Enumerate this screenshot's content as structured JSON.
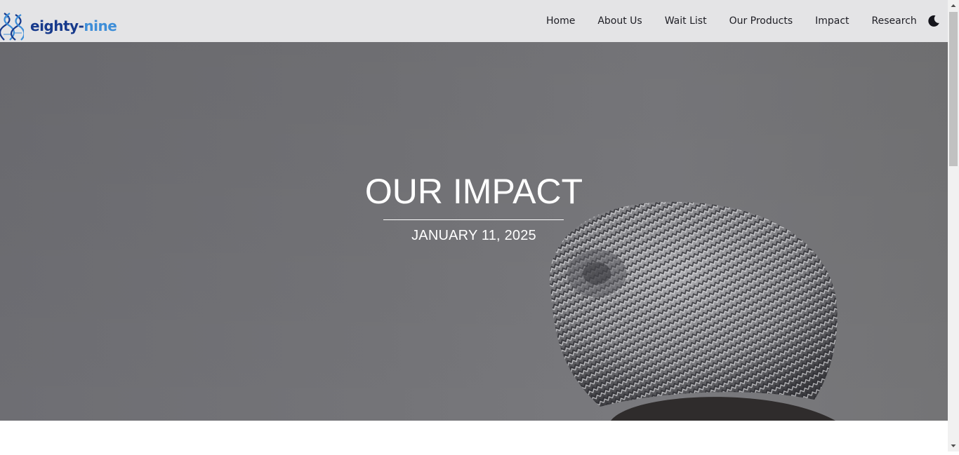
{
  "brand": {
    "name_part1": "eighty-",
    "name_part2": "nine",
    "logo_icon": "dna-helix-logo",
    "color_dark": "#173a8c",
    "color_light": "#3e8ed8"
  },
  "nav": {
    "items": [
      {
        "label": "Home"
      },
      {
        "label": "About Us"
      },
      {
        "label": "Wait List"
      },
      {
        "label": "Our Products"
      },
      {
        "label": "Impact"
      },
      {
        "label": "Research"
      }
    ],
    "theme_toggle_icon": "moon-icon"
  },
  "hero": {
    "title": "OUR IMPACT",
    "date": "JANUARY 11, 2025",
    "image_subject": "knit-beanie-photo"
  },
  "colors": {
    "navbar_bg": "#e4e4e6",
    "hero_overlay": "#727276",
    "text_light": "#ffffff",
    "nav_text": "#1d1d24"
  }
}
